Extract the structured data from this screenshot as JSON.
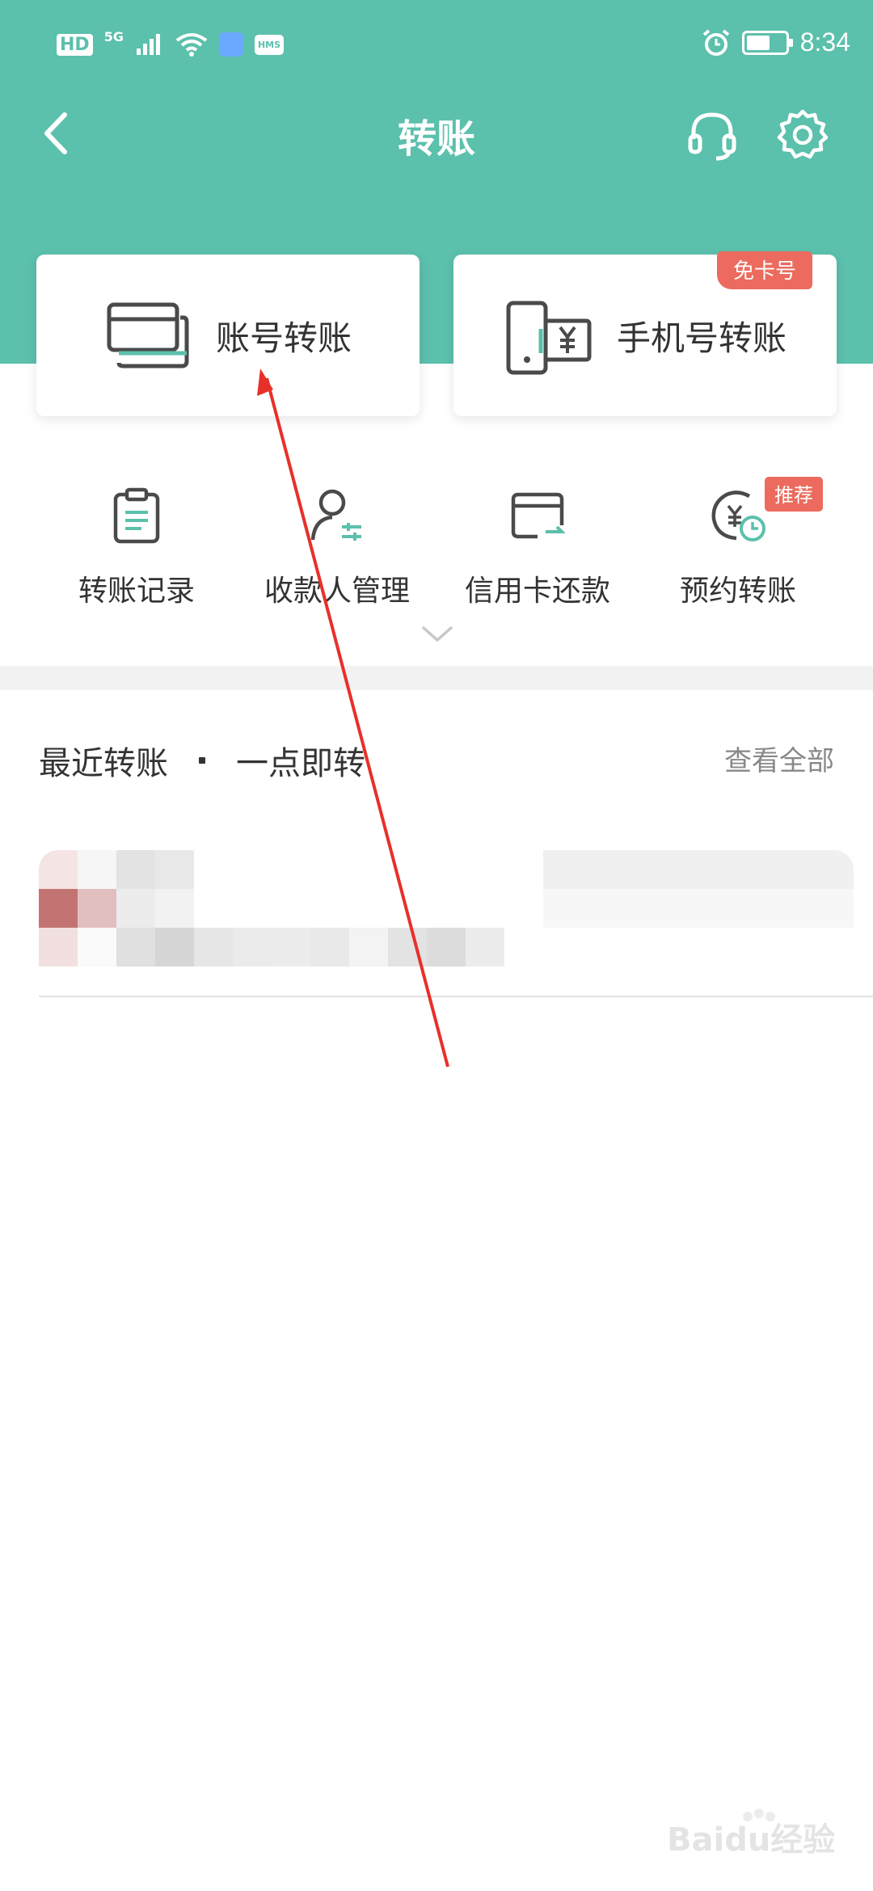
{
  "status_bar": {
    "hd": "HD",
    "network": "5G",
    "hms": "HMS",
    "time": "8:34",
    "battery_level": 0.6
  },
  "nav": {
    "title": "转账",
    "back_icon": "chevron-left-icon",
    "service_icon": "headset-icon",
    "settings_icon": "gear-icon"
  },
  "cards": [
    {
      "label": "账号转账",
      "icon": "bank-card-icon",
      "badge": ""
    },
    {
      "label": "手机号转账",
      "icon": "phone-yuan-icon",
      "badge": "免卡号"
    }
  ],
  "grid": [
    {
      "label": "转账记录",
      "icon": "clipboard-icon",
      "badge": ""
    },
    {
      "label": "收款人管理",
      "icon": "payee-manage-icon",
      "badge": ""
    },
    {
      "label": "信用卡还款",
      "icon": "credit-card-icon",
      "badge": ""
    },
    {
      "label": "预约转账",
      "icon": "yuan-clock-icon",
      "badge": "推荐"
    }
  ],
  "recent": {
    "title": "最近转账",
    "subtitle": "一点即转",
    "view_all": "查看全部"
  },
  "watermark": {
    "text": "Baidu经验"
  },
  "colors": {
    "header": "#5bc0ac",
    "badge": "#ec6b5e",
    "accent_green": "#4fb89f",
    "annotation_arrow": "#e8302a"
  }
}
